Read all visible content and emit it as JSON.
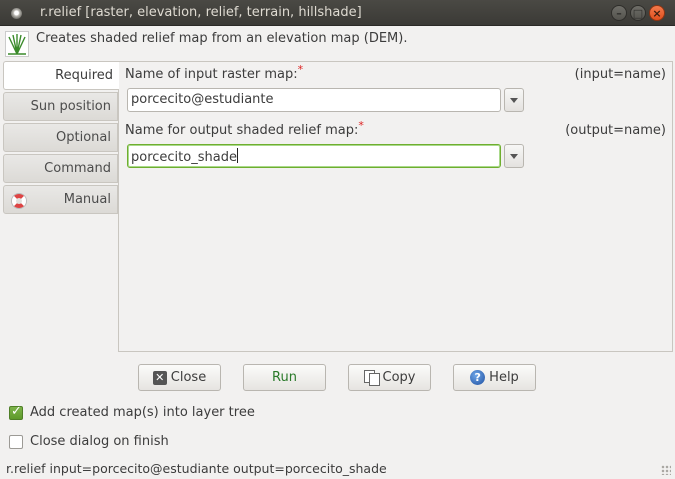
{
  "window": {
    "title": "r.relief [raster, elevation, relief, terrain, hillshade]"
  },
  "description": "Creates shaded relief map from an elevation map (DEM).",
  "tabs": [
    {
      "label": "Required",
      "active": true
    },
    {
      "label": "Sun position",
      "active": false
    },
    {
      "label": "Optional",
      "active": false
    },
    {
      "label": "Command output",
      "active": false
    },
    {
      "label": "Manual",
      "active": false,
      "icon": "lifebuoy-icon"
    }
  ],
  "required": {
    "input_label": "Name of input raster map:",
    "input_param": "(input=name)",
    "input_value": "porcecito@estudiante",
    "output_label": "Name for output shaded relief map:",
    "output_param": "(output=name)",
    "output_value": "porcecito_shade",
    "required_mark": "*"
  },
  "buttons": {
    "close": "Close",
    "run": "Run",
    "copy": "Copy",
    "help": "Help"
  },
  "options": {
    "add_to_layer_tree": {
      "label": "Add created map(s) into layer tree",
      "checked": true
    },
    "close_on_finish": {
      "label": "Close dialog on finish",
      "checked": false
    }
  },
  "command_line": "r.relief input=porcecito@estudiante output=porcecito_shade",
  "colors": {
    "titlebar": "#3b3a36",
    "focus_border": "#6fae2f",
    "required_star": "#dd2222",
    "run_text": "#2a7a2a",
    "close_window_button": "#e04f1d"
  }
}
